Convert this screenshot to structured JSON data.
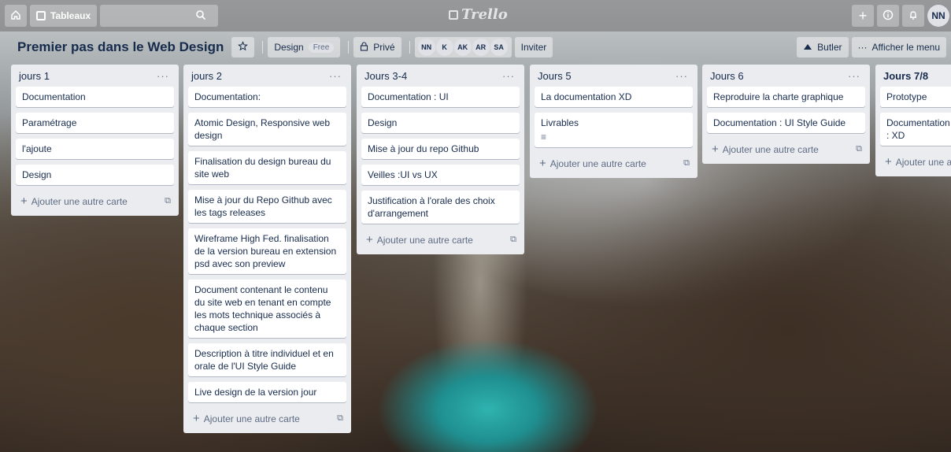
{
  "topbar": {
    "home_icon": "home-icon",
    "boards_label": "Tableaux",
    "search_icon": "search-icon",
    "logo_text": "Trello",
    "user_initials": "NN"
  },
  "board": {
    "title": "Premier pas dans le Web Design",
    "team_label": "Design",
    "team_badge": "Free",
    "visibility_label": "Privé",
    "members": [
      "NN",
      "K",
      "AK",
      "AR",
      "SA"
    ],
    "invite_label": "Inviter",
    "butler_label": "Butler",
    "menu_label": "Afficher le menu"
  },
  "lists": [
    {
      "title": "jours 1",
      "cards": [
        "Documentation",
        "Paramétrage",
        "l'ajoute",
        "Design"
      ],
      "add_label": "Ajouter une autre carte"
    },
    {
      "title": "jours 2",
      "cards": [
        "Documentation:",
        "Atomic Design, Responsive web design",
        "Finalisation du design bureau du site web",
        "Mise à jour du Repo Github avec les tags releases",
        "Wireframe High Fed. finalisation de la version bureau en extension psd avec son preview",
        "Document contenant le contenu du site web en tenant en compte les mots technique associés à chaque section",
        "Description à titre individuel et en orale de l'UI Style Guide",
        "Live design de la version jour"
      ],
      "add_label": "Ajouter une autre carte"
    },
    {
      "title": "Jours 3-4",
      "cards": [
        "Documentation : UI",
        "Design",
        "Mise à jour du repo Github",
        "Veilles :UI vs UX",
        "Justification à l'orale des choix d'arrangement"
      ],
      "add_label": "Ajouter une autre carte"
    },
    {
      "title": "Jours 5",
      "cards": [
        "La documentation XD",
        "Livrables"
      ],
      "add_label": "Ajouter une autre carte"
    },
    {
      "title": "Jours 6",
      "cards": [
        "Reproduire la charte graphique",
        "Documentation : UI Style Guide"
      ],
      "add_label": "Ajouter une autre carte"
    },
    {
      "title": "Jours 7/8",
      "cards": [
        "Prototype",
        "Documentation : XD"
      ],
      "add_label": "Ajouter une a"
    }
  ],
  "colors": {
    "list_bg": "#ebecf0",
    "card_bg": "#ffffff",
    "text": "#172b4d",
    "muted": "#5e6c84"
  }
}
